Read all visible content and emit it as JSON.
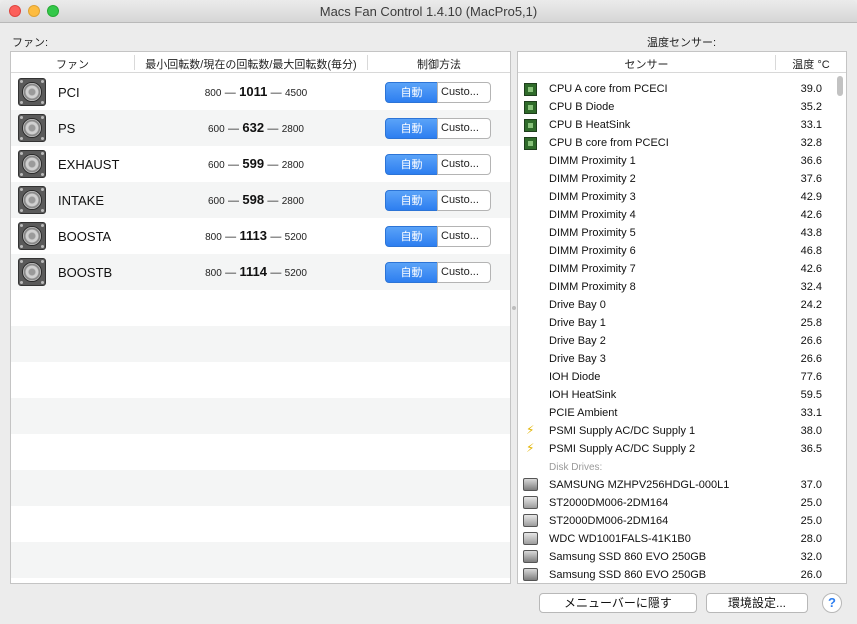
{
  "window": {
    "title": "Macs Fan Control 1.4.10 (MacPro5,1)"
  },
  "fans_section": {
    "label": "ファン:",
    "columns": {
      "fan": "ファン",
      "speed": "最小回転数/現在の回転数/最大回転数(毎分)",
      "control": "制御方法"
    },
    "auto_label": "自動",
    "custom_label": "Custo...",
    "dash": "—",
    "fans": [
      {
        "name": "PCI",
        "min": "800",
        "current": "1011",
        "max": "4500"
      },
      {
        "name": "PS",
        "min": "600",
        "current": "632",
        "max": "2800"
      },
      {
        "name": "EXHAUST",
        "min": "600",
        "current": "599",
        "max": "2800"
      },
      {
        "name": "INTAKE",
        "min": "600",
        "current": "598",
        "max": "2800"
      },
      {
        "name": "BOOSTA",
        "min": "800",
        "current": "1113",
        "max": "5200"
      },
      {
        "name": "BOOSTB",
        "min": "800",
        "current": "1114",
        "max": "5200"
      }
    ]
  },
  "sensors_section": {
    "label": "温度センサー:",
    "columns": {
      "sensor": "センサー",
      "temp": "温度 °C"
    },
    "sensors": [
      {
        "icon": "chip-icon",
        "name": "CPU A core from PCECI",
        "value": "39.0"
      },
      {
        "icon": "chip-icon",
        "name": "CPU B Diode",
        "value": "35.2"
      },
      {
        "icon": "chip-icon",
        "name": "CPU B HeatSink",
        "value": "33.1"
      },
      {
        "icon": "chip-icon",
        "name": "CPU B core from PCECI",
        "value": "32.8"
      },
      {
        "icon": "",
        "name": "DIMM Proximity 1",
        "value": "36.6"
      },
      {
        "icon": "",
        "name": "DIMM Proximity 2",
        "value": "37.6"
      },
      {
        "icon": "",
        "name": "DIMM Proximity 3",
        "value": "42.9"
      },
      {
        "icon": "",
        "name": "DIMM Proximity 4",
        "value": "42.6"
      },
      {
        "icon": "",
        "name": "DIMM Proximity 5",
        "value": "43.8"
      },
      {
        "icon": "",
        "name": "DIMM Proximity 6",
        "value": "46.8"
      },
      {
        "icon": "",
        "name": "DIMM Proximity 7",
        "value": "42.6"
      },
      {
        "icon": "",
        "name": "DIMM Proximity 8",
        "value": "32.4"
      },
      {
        "icon": "",
        "name": "Drive Bay 0",
        "value": "24.2"
      },
      {
        "icon": "",
        "name": "Drive Bay 1",
        "value": "25.8"
      },
      {
        "icon": "",
        "name": "Drive Bay 2",
        "value": "26.6"
      },
      {
        "icon": "",
        "name": "Drive Bay 3",
        "value": "26.6"
      },
      {
        "icon": "",
        "name": "IOH Diode",
        "value": "77.6"
      },
      {
        "icon": "",
        "name": "IOH HeatSink",
        "value": "59.5"
      },
      {
        "icon": "",
        "name": "PCIE Ambient",
        "value": "33.1"
      },
      {
        "icon": "power-icon",
        "name": "PSMI Supply AC/DC Supply 1",
        "value": "38.0"
      },
      {
        "icon": "power-icon",
        "name": "PSMI Supply AC/DC Supply 2",
        "value": "36.5"
      }
    ],
    "disk_group_label": "Disk Drives:",
    "disks": [
      {
        "icon": "ssd-icon",
        "name": "SAMSUNG MZHPV256HDGL-000L1",
        "value": "37.0"
      },
      {
        "icon": "hdd-icon",
        "name": "ST2000DM006-2DM164",
        "value": "25.0"
      },
      {
        "icon": "hdd-icon",
        "name": "ST2000DM006-2DM164",
        "value": "25.0"
      },
      {
        "icon": "hdd-icon",
        "name": "WDC WD1001FALS-41K1B0",
        "value": "28.0"
      },
      {
        "icon": "ssd-icon",
        "name": "Samsung SSD 860 EVO 250GB",
        "value": "32.0"
      },
      {
        "icon": "ssd-icon",
        "name": "Samsung SSD 860 EVO 250GB",
        "value": "26.0"
      }
    ]
  },
  "footer": {
    "hide_to_menubar": "メニューバーに隠す",
    "preferences": "環境設定...",
    "help": "?"
  }
}
